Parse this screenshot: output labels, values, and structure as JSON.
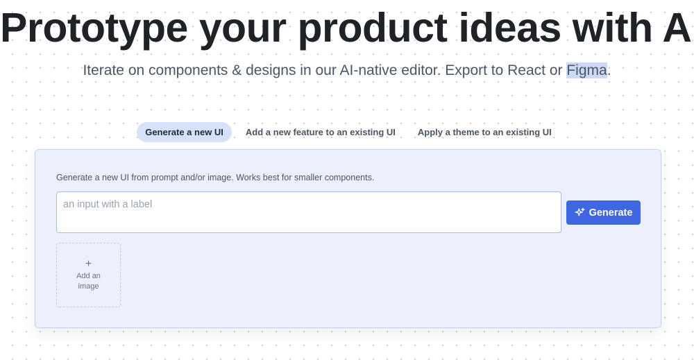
{
  "hero": {
    "title": "Prototype your product ideas with AI.",
    "subtitle_before": "Iterate on components & designs in our AI-native editor. Export to React or ",
    "subtitle_highlight": "Figma",
    "subtitle_after": "."
  },
  "tabs": [
    {
      "label": "Generate a new UI",
      "active": true
    },
    {
      "label": "Add a new feature to an existing UI",
      "active": false
    },
    {
      "label": "Apply a theme to an existing UI",
      "active": false
    }
  ],
  "panel": {
    "hint": "Generate a new UI from prompt and/or image. Works best for smaller components.",
    "input_placeholder": "an input with a label",
    "input_value": "",
    "generate_label": "Generate",
    "generate_icon": "sparkle-icon",
    "add_image_icon": "plus-icon",
    "add_image_label": "Add an image"
  },
  "colors": {
    "accent": "#4066e0",
    "active_tab_bg": "#d8e1fb",
    "panel_bg": "#ebf0fc",
    "highlight": "#cdd9f5"
  }
}
